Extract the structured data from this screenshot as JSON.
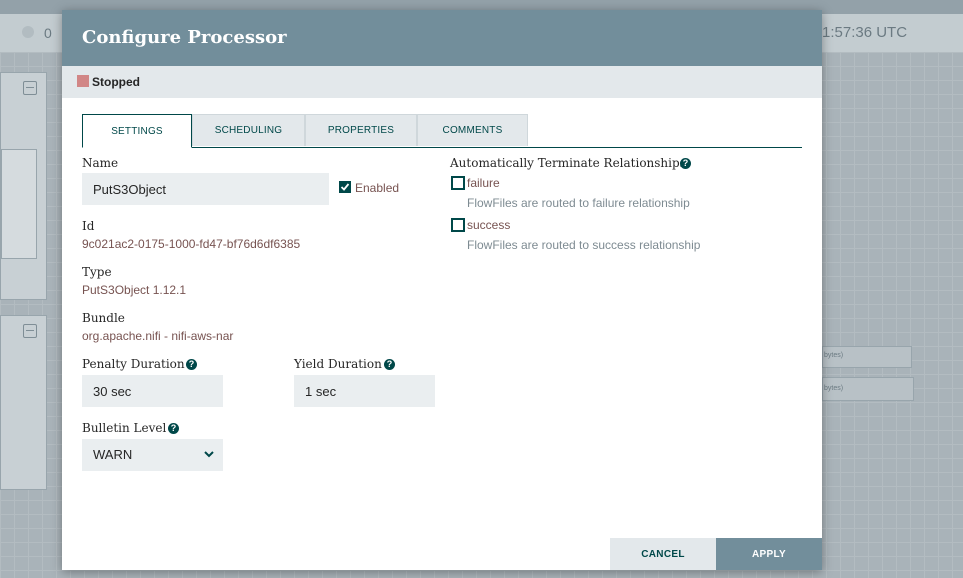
{
  "background": {
    "stat_count": "0",
    "clock": "1:57:36 UTC",
    "conn_labels": [
      "bytes)",
      "bytes)"
    ]
  },
  "dialog": {
    "title": "Configure Processor",
    "status": {
      "label": "Stopped",
      "color": "#d18686"
    },
    "tabs": [
      {
        "label": "SETTINGS",
        "active": true
      },
      {
        "label": "SCHEDULING",
        "active": false
      },
      {
        "label": "PROPERTIES",
        "active": false
      },
      {
        "label": "COMMENTS",
        "active": false
      }
    ],
    "settings": {
      "name_label": "Name",
      "name_value": "PutS3Object",
      "enabled_label": "Enabled",
      "enabled_checked": true,
      "id_label": "Id",
      "id_value": "9c021ac2-0175-1000-fd47-bf76d6df6385",
      "type_label": "Type",
      "type_value": "PutS3Object 1.12.1",
      "bundle_label": "Bundle",
      "bundle_value": "org.apache.nifi - nifi-aws-nar",
      "penalty_label": "Penalty Duration",
      "penalty_value": "30 sec",
      "yield_label": "Yield Duration",
      "yield_value": "1 sec",
      "bulletin_label": "Bulletin Level",
      "bulletin_value": "WARN"
    },
    "relationships": {
      "header": "Automatically Terminate Relationships",
      "items": [
        {
          "name": "failure",
          "description": "FlowFiles are routed to failure relationship",
          "checked": false
        },
        {
          "name": "success",
          "description": "FlowFiles are routed to success relationship",
          "checked": false
        }
      ]
    },
    "buttons": {
      "cancel": "CANCEL",
      "apply": "APPLY"
    }
  },
  "colors": {
    "header": "#728e9b",
    "accent": "#004849",
    "value_text": "#775351"
  }
}
